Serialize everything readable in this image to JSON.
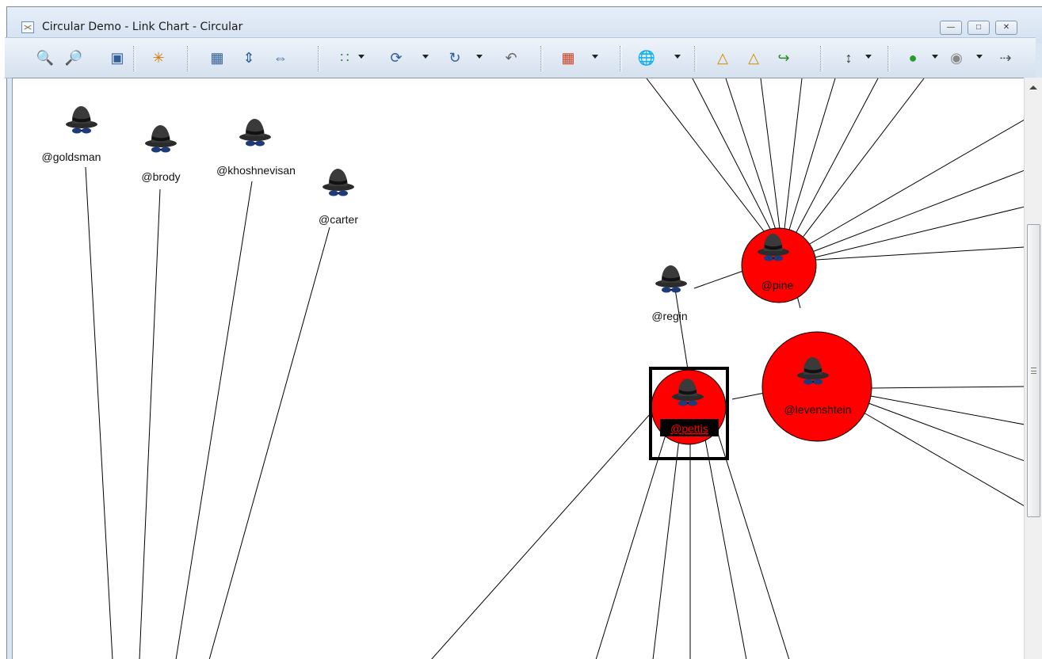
{
  "window": {
    "title": "Circular Demo - Link Chart - Circular",
    "buttons": [
      "minimize",
      "maximize",
      "close"
    ]
  },
  "toolbar": {
    "icons": [
      "zoom-in-icon",
      "zoom-out-icon",
      "fit-window-icon",
      "highlight-icon",
      "fit-all-icon",
      "fit-vertical-icon",
      "fit-horizontal-icon",
      "layout-icon",
      "refresh-layout-icon",
      "relayout-icon",
      "undo-icon",
      "calendar-icon",
      "globe-icon",
      "link-left-icon",
      "link-right-icon",
      "export-icon",
      "hierarchy-icon",
      "node-style-icon",
      "properties-icon",
      "path-icon"
    ]
  },
  "nodes": [
    {
      "id": "goldsman",
      "label": "@goldsman",
      "selected": false,
      "highlighted": false
    },
    {
      "id": "brody",
      "label": "@brody",
      "selected": false,
      "highlighted": false
    },
    {
      "id": "khoshnevisan",
      "label": "@khoshnevisan",
      "selected": false,
      "highlighted": false
    },
    {
      "id": "carter",
      "label": "@carter",
      "selected": false,
      "highlighted": false
    },
    {
      "id": "regin",
      "label": "@regin",
      "selected": false,
      "highlighted": false
    },
    {
      "id": "pine",
      "label": "@pine",
      "selected": false,
      "highlighted": true
    },
    {
      "id": "levenshtein",
      "label": "@levenshtein",
      "selected": false,
      "highlighted": true
    },
    {
      "id": "pettis",
      "label": "@pettis",
      "selected": true,
      "highlighted": true
    }
  ],
  "colors": {
    "highlight": "#ff0000",
    "selection": "#000000",
    "edge": "#000000"
  }
}
